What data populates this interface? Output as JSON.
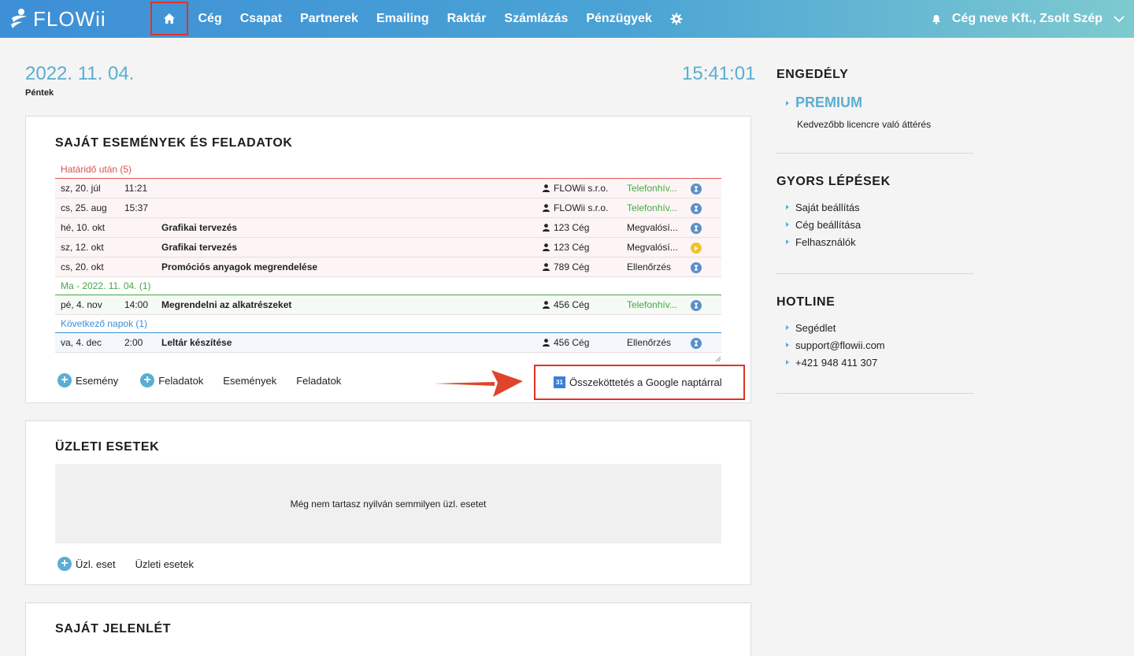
{
  "header": {
    "logo_text": "FLOWii",
    "nav": [
      "Cég",
      "Csapat",
      "Partnerek",
      "Emailing",
      "Raktár",
      "Számlázás",
      "Pénzügyek"
    ],
    "company_user": "Cég neve Kft., Zsolt Szép",
    "icons": {
      "home": "home-icon",
      "settings": "gear-icon",
      "bell": "bell-icon",
      "menu": "chevron-down-icon"
    }
  },
  "today": {
    "date": "2022. 11. 04.",
    "day": "Péntek",
    "time": "15:41:01"
  },
  "tasks_card": {
    "title": "SAJÁT ESEMÉNYEK ÉS FELADATOK",
    "groups": [
      {
        "label": "Határidő után (5)",
        "color": "#d9534f",
        "rows": [
          {
            "date": "sz, 20. júl",
            "time": "11:21",
            "title": "",
            "person": "FLOWii s.r.o.",
            "type": "Telefonhív...",
            "type_color": "#45a745",
            "status": "hourglass"
          },
          {
            "date": "cs, 25. aug",
            "time": "15:37",
            "title": "",
            "person": "FLOWii s.r.o.",
            "type": "Telefonhív...",
            "type_color": "#45a745",
            "status": "hourglass"
          },
          {
            "date": "hé, 10. okt",
            "time": "",
            "title": "Grafikai tervezés",
            "person": "123 Cég",
            "type": "Megvalósí...",
            "type_color": "#222222",
            "status": "hourglass"
          },
          {
            "date": "sz, 12. okt",
            "time": "",
            "title": "Grafikai tervezés",
            "person": "123 Cég",
            "type": "Megvalósí...",
            "type_color": "#222222",
            "status": "play"
          },
          {
            "date": "cs, 20. okt",
            "time": "",
            "title": "Promóciós anyagok megrendelése",
            "person": "789 Cég",
            "type": "Ellenőrzés",
            "type_color": "#222222",
            "status": "hourglass"
          }
        ]
      },
      {
        "label": "Ma - 2022. 11. 04. (1)",
        "color": "#45a745",
        "rows": [
          {
            "date": "pé, 4. nov",
            "time": "14:00",
            "title": "Megrendelni az alkatrészeket",
            "person": "456 Cég",
            "type": "Telefonhív...",
            "type_color": "#45a745",
            "status": "hourglass"
          }
        ]
      },
      {
        "label": "Következő napok (1)",
        "color": "#3d8fd6",
        "rows": [
          {
            "date": "va, 4. dec",
            "time": "2:00",
            "title": "Leltár készítése",
            "person": "456 Cég",
            "type": "Ellenőrzés",
            "type_color": "#222222",
            "status": "hourglass"
          }
        ]
      }
    ],
    "actions": {
      "add_event": "Esemény",
      "add_task": "Feladatok",
      "events": "Események",
      "tasks": "Feladatok"
    },
    "google_link": "Összeköttetés a Google naptárral",
    "google_icon_text": "31"
  },
  "cases_card": {
    "title": "ÜZLETI ESETEK",
    "empty": "Még nem tartasz nyilván semmilyen üzl. esetet",
    "add_case": "Üzl. eset",
    "cases_link": "Üzleti esetek"
  },
  "attendance_card": {
    "title": "SAJÁT JELENLÉT"
  },
  "sidebar": {
    "license": {
      "title": "ENGEDÉLY",
      "plan": "PREMIUM",
      "upgrade": "Kedvezőbb licencre való áttérés"
    },
    "quick": {
      "title": "GYORS LÉPÉSEK",
      "items": [
        "Saját beállítás",
        "Cég beállítása",
        "Felhasználók"
      ]
    },
    "hotline": {
      "title": "HOTLINE",
      "items": [
        "Segédlet",
        "support@flowii.com",
        "+421 948 411 307"
      ]
    }
  },
  "colors": {
    "accent": "#5aaed1",
    "highlight_red": "#e0322a",
    "hourglass": "#5a8fc8",
    "play": "#f2c12e"
  }
}
